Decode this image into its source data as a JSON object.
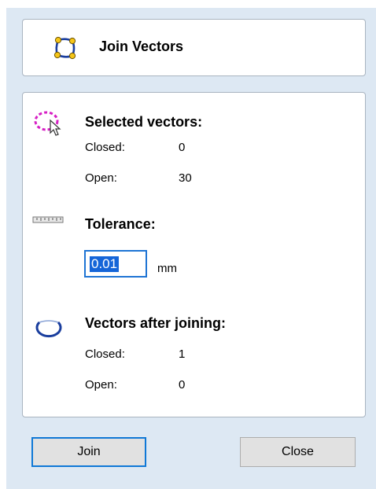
{
  "title": {
    "text": "Join Vectors",
    "icon": "join-vectors-icon"
  },
  "selected": {
    "heading": "Selected vectors:",
    "icon": "selected-vectors-icon",
    "closed_label": "Closed:",
    "closed_value": "0",
    "open_label": "Open:",
    "open_value": "30"
  },
  "tolerance": {
    "heading": "Tolerance:",
    "icon": "ruler-icon",
    "value": "0.01",
    "unit": "mm"
  },
  "after": {
    "heading": "Vectors after joining:",
    "icon": "joined-vector-icon",
    "closed_label": "Closed:",
    "closed_value": "1",
    "open_label": "Open:",
    "open_value": "0"
  },
  "buttons": {
    "join": "Join",
    "close": "Close"
  },
  "colors": {
    "panel_bg": "#dde8f3",
    "accent": "#1565d8",
    "selection_magenta": "#d61fc4",
    "node_yellow": "#f5c518"
  }
}
